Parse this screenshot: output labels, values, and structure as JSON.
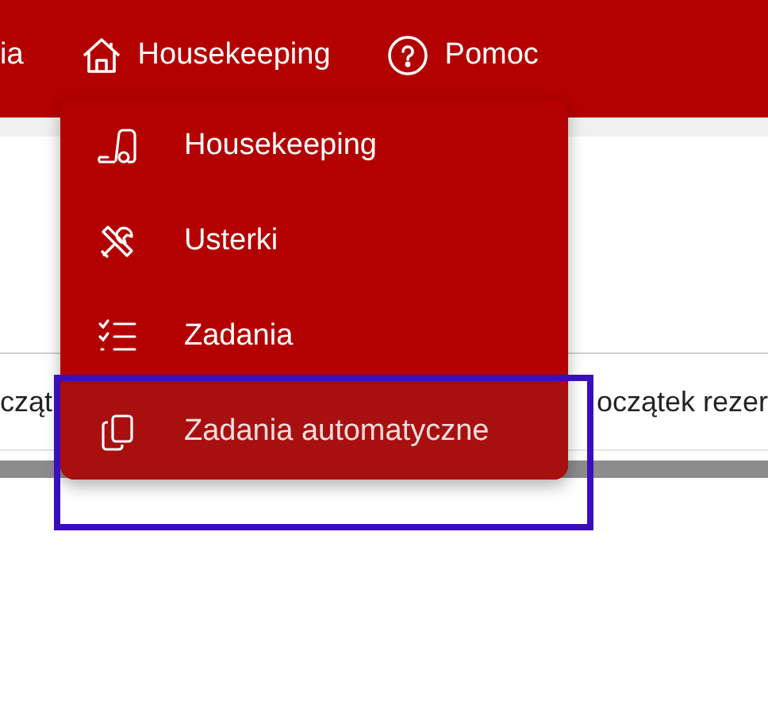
{
  "nav": [
    {
      "label": "ia"
    },
    {
      "label": "Housekeeping"
    },
    {
      "label": "Pomoc"
    }
  ],
  "table": {
    "header": [
      "cząt",
      "oczątek rezer"
    ]
  },
  "menu": {
    "items": [
      {
        "label": "Housekeeping",
        "selected": false
      },
      {
        "label": "Usterki",
        "selected": false
      },
      {
        "label": "Zadania",
        "selected": false
      },
      {
        "label": "Zadania automatyczne",
        "selected": true
      }
    ]
  }
}
